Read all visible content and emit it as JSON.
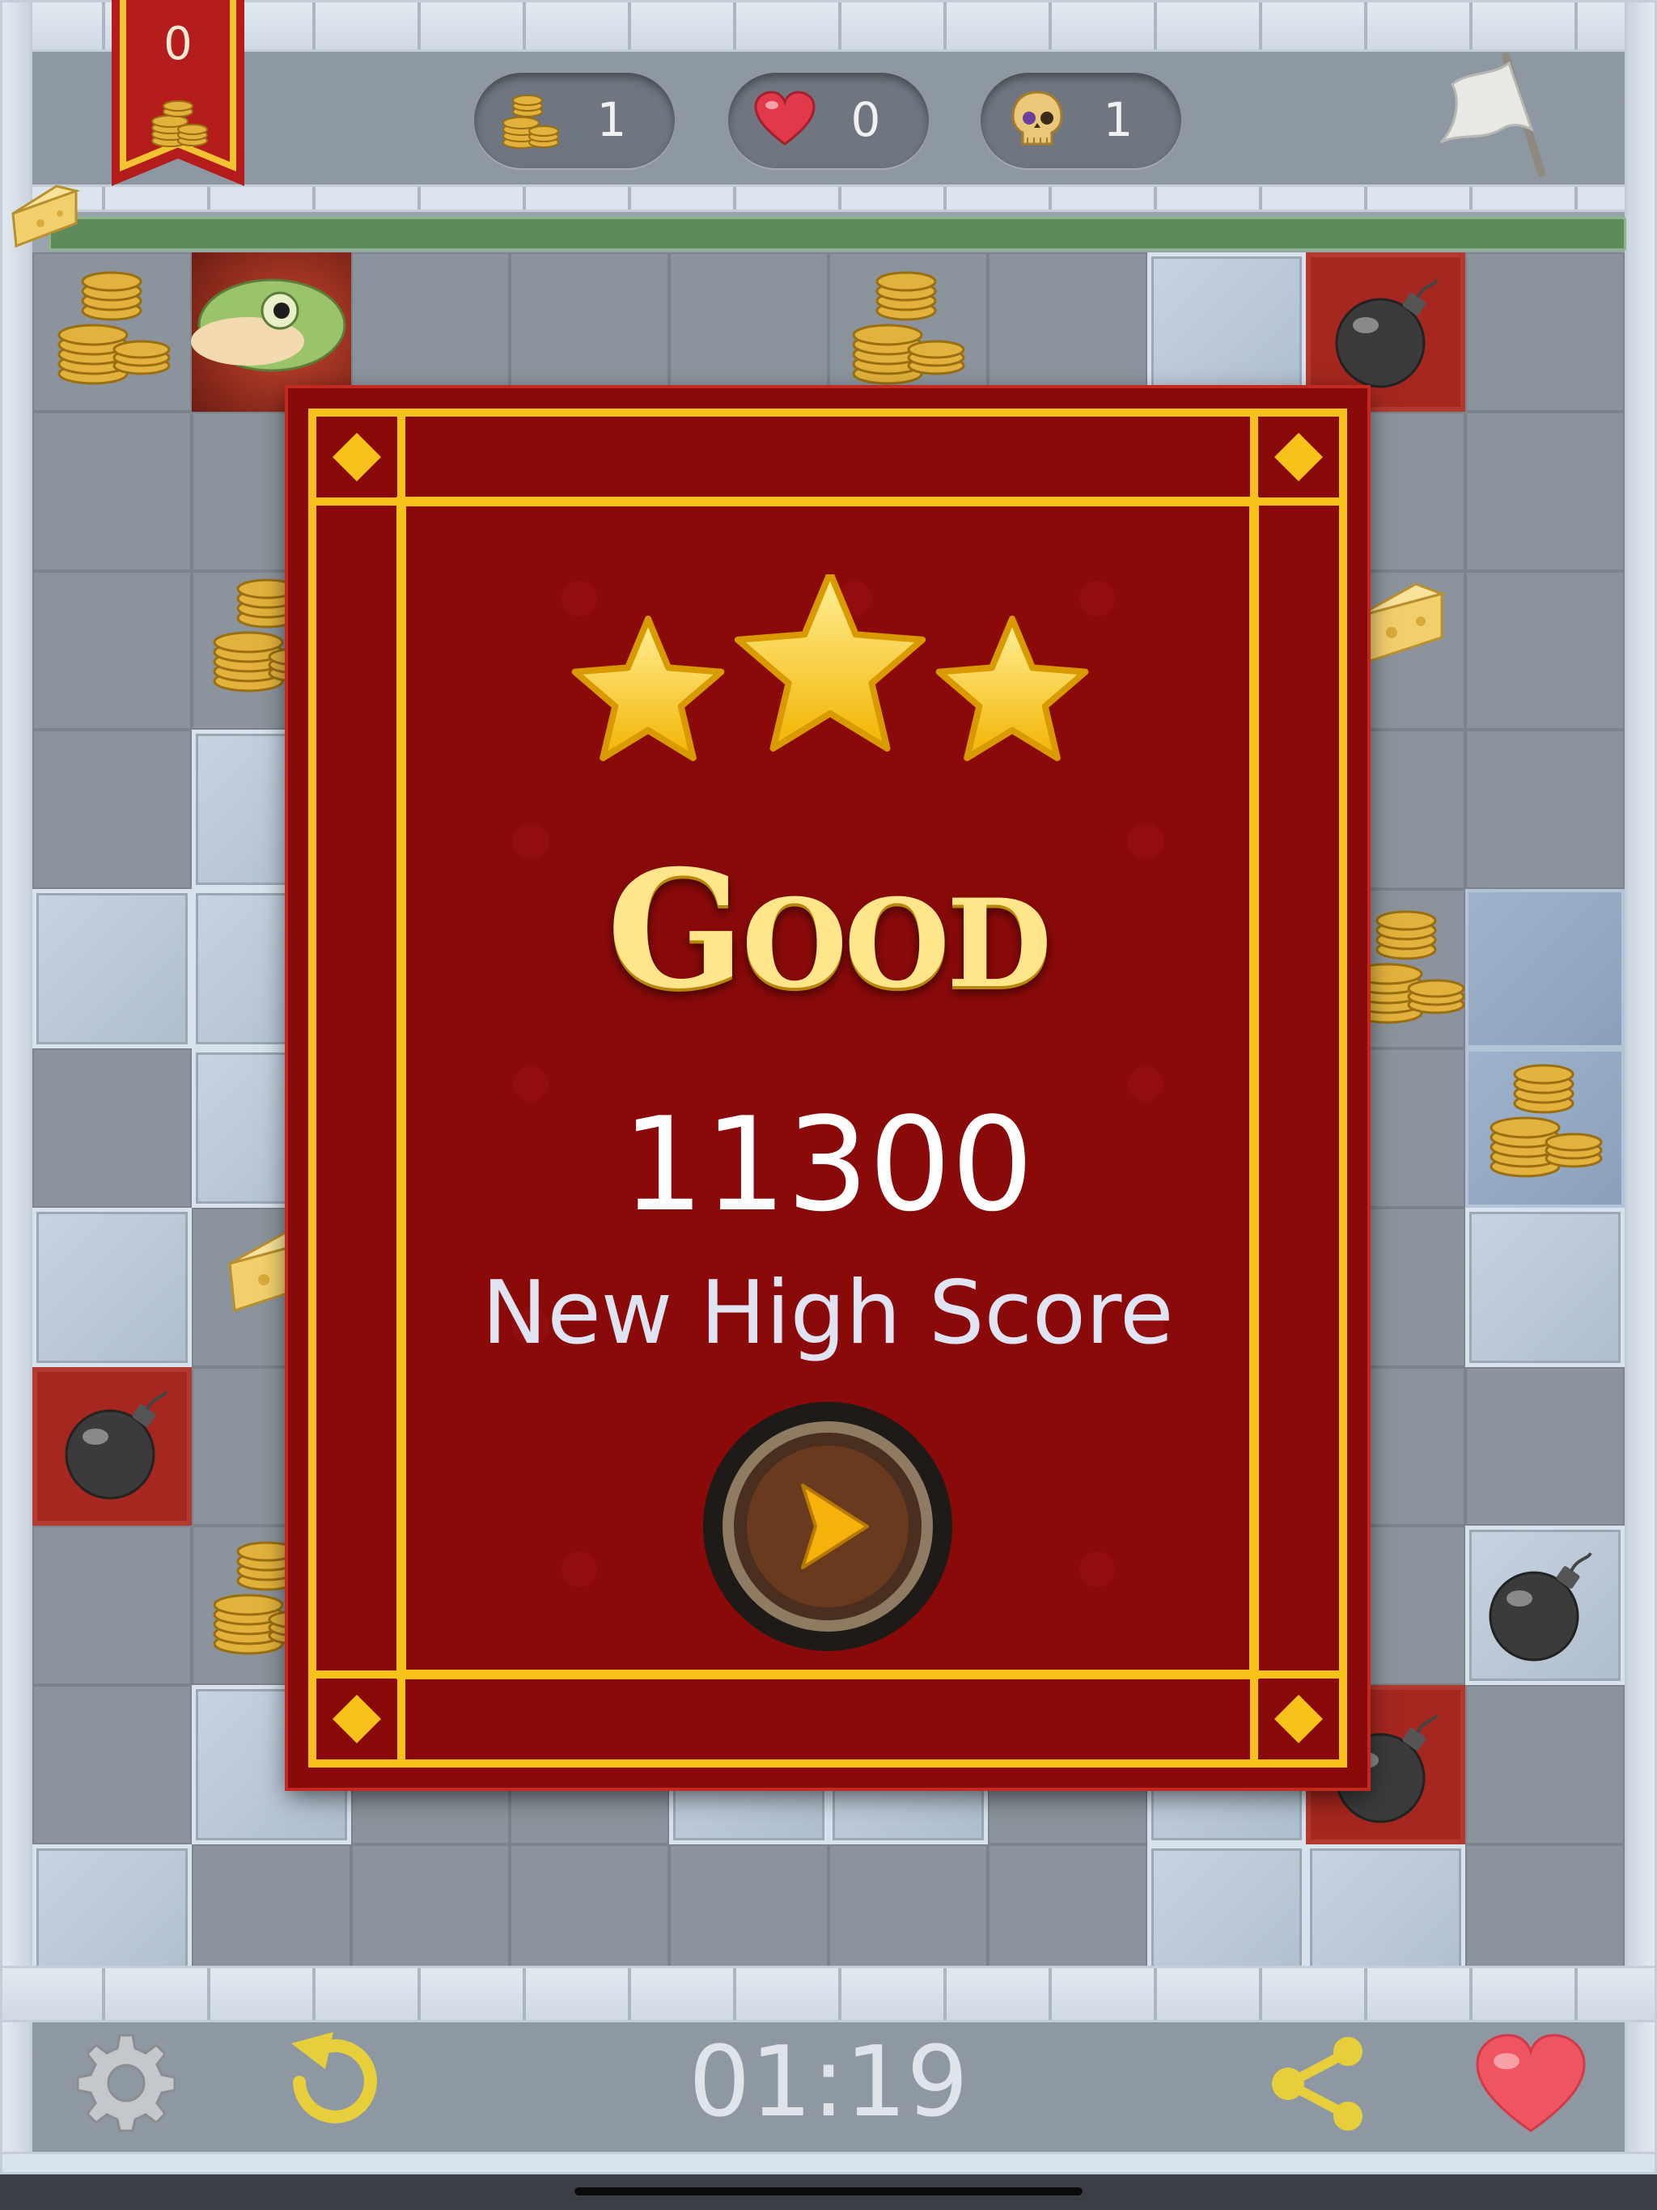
{
  "hud": {
    "banner_count": "0",
    "coins_count": "1",
    "lives_count": "0",
    "kills_count": "1",
    "icons": {
      "banner": "coin-stack-icon",
      "coins": "coin-stack-icon",
      "lives": "heart-icon",
      "kills": "skull-icon",
      "surrender": "white-flag-icon"
    }
  },
  "board": {
    "progress_fraction": 1.0,
    "colors": {
      "stone": "#8b939c",
      "light_stone": "#bccadb",
      "red_tile": "#a5271f",
      "progress": "#5f8a5c"
    }
  },
  "result": {
    "stars_earned": 3,
    "stars_total": 3,
    "rating_first": "G",
    "rating_rest": "OOD",
    "score": "11300",
    "message": "New High Score",
    "next_icon": "play-arrow-icon",
    "colors": {
      "card": "#8a0a0a",
      "frame": "#f6c21a",
      "star": "#ffd12a"
    }
  },
  "footer": {
    "timer": "01:19",
    "icons": {
      "settings": "gear-icon",
      "restart": "restart-icon",
      "share": "share-icon",
      "like": "heart-icon"
    }
  }
}
